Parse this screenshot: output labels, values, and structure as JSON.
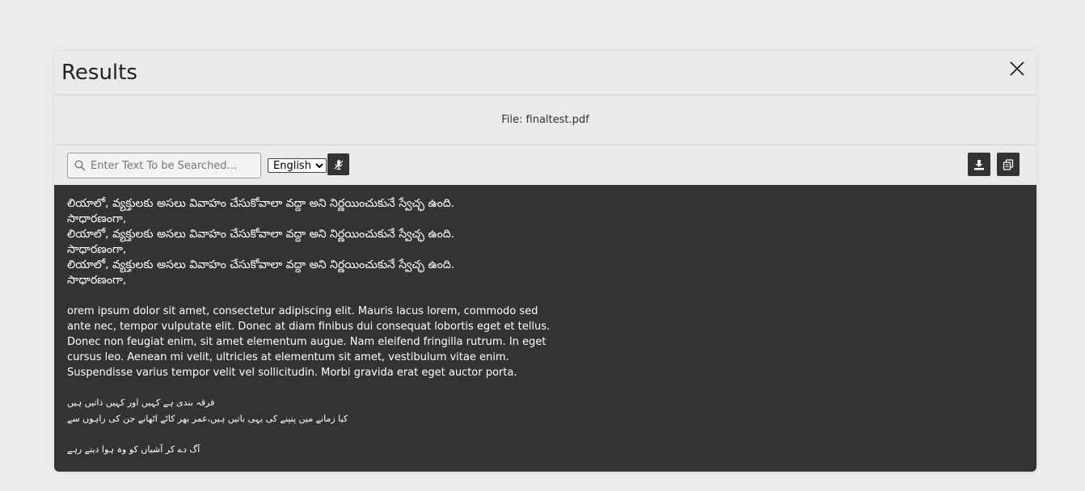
{
  "modal": {
    "title": "Results",
    "file_label": "File: finaltest.pdf"
  },
  "toolbar": {
    "search_placeholder": "Enter Text To be Searched...",
    "search_value": "",
    "language_selected": "English",
    "language_options": [
      "English"
    ]
  },
  "icons": {
    "close": "close-icon",
    "search": "search-icon",
    "mic": "microphone-off-icon",
    "download": "download-icon",
    "copy": "copy-icon"
  },
  "content": {
    "telugu_lines": [
      "లియాలో, వ్యక్తులకు అసలు వివాహం చేసుకోవాలా వద్దా అని నిర్ణయించుకునే స్వేచ్ఛ ఉంది.",
      "సాధారణంగా,",
      "లియాలో, వ్యక్తులకు అసలు వివాహం చేసుకోవాలా వద్దా అని నిర్ణయించుకునే స్వేచ్ఛ ఉంది.",
      "సాధారణంగా,",
      "లియాలో, వ్యక్తులకు అసలు వివాహం చేసుకోవాలా వద్దా అని నిర్ణయించుకునే స్వేచ్ఛ ఉంది.",
      "సాధారణంగా,"
    ],
    "latin_paragraph": "orem ipsum dolor sit amet, consectetur adipiscing elit. Mauris lacus lorem, commodo sed ante nec, tempor vulputate elit. Donec at diam finibus dui consequat lobortis eget et tellus. Donec non feugiat enim, sit amet elementum augue. Nam eleifend fringilla rutrum. In eget cursus leo. Aenean mi velit, ultricies at elementum sit amet, vestibulum vitae enim. Suspendisse varius tempor velit vel sollicitudin. Morbi gravida erat eget auctor porta.",
    "urdu_lines": [
      "فرقہ بندی ہے کہیں اور کہیں ذاتیں ہیں",
      "کیا زمانے میں پنپنے کی یہی باتیں ہیں،عمر بھر کاٹے اٹھانے جن کی راہوں سے",
      "",
      "آگ دے کر آشیاں کو وہ ہوا دیتے رہے"
    ]
  },
  "colors": {
    "page_bg": "#ececec",
    "modal_bg": "#eaeaea",
    "content_bg": "#333333",
    "button_bg": "#333333"
  }
}
